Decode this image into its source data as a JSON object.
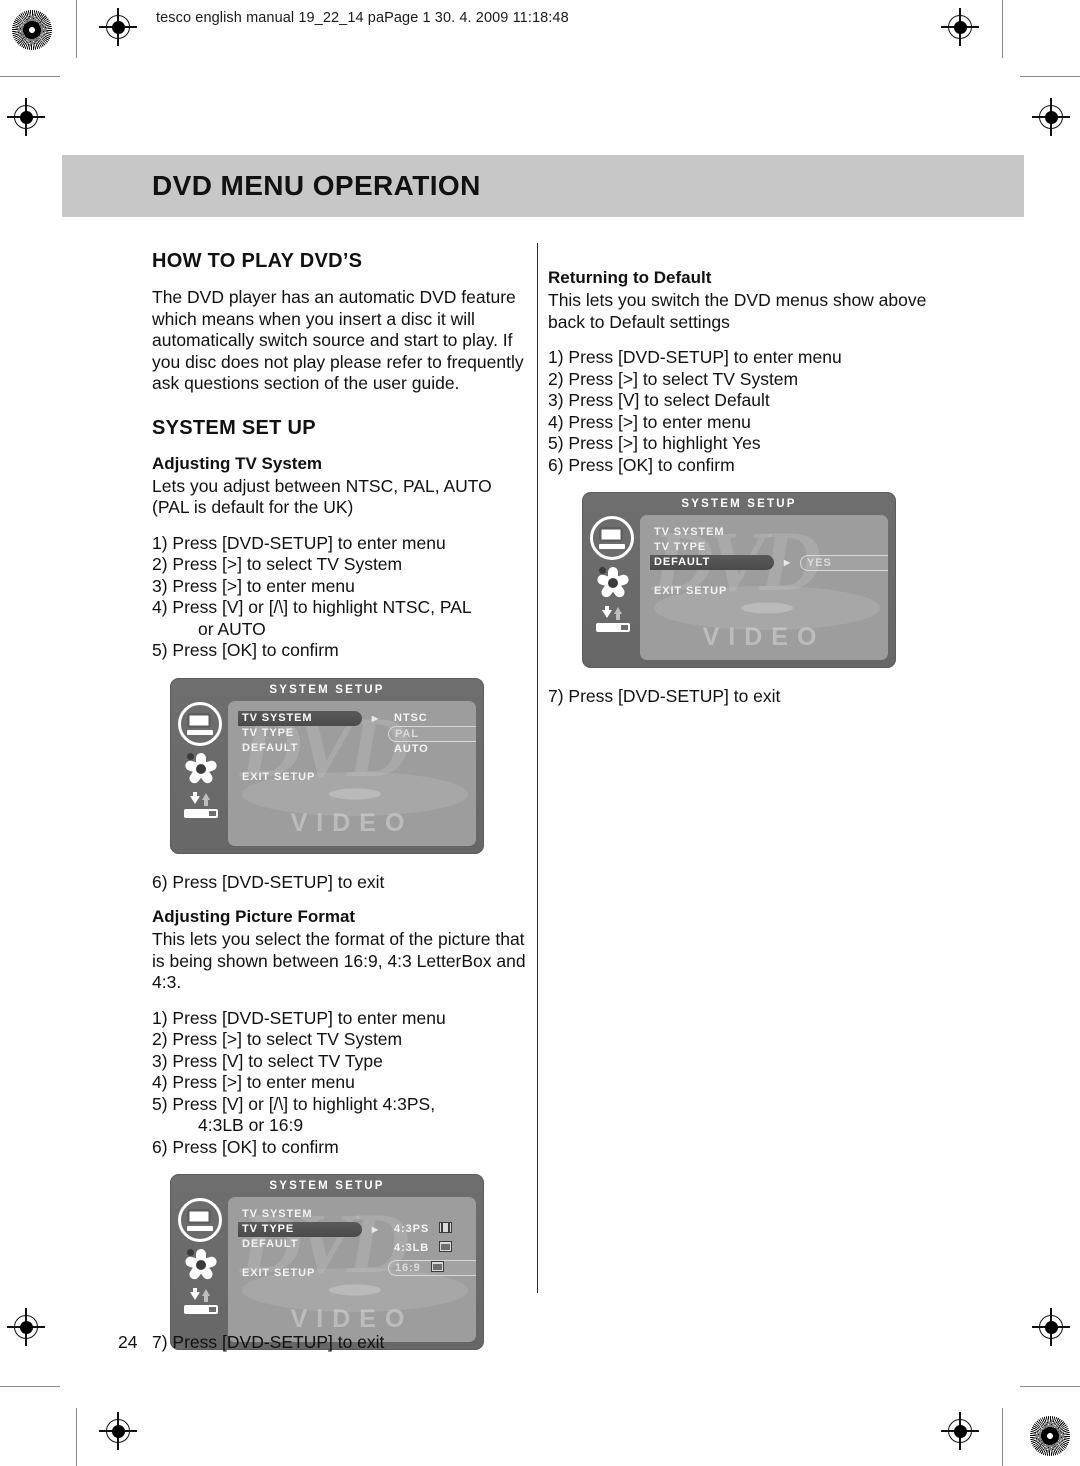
{
  "page_header": "tesco english manual 19_22_14 paPage 1   30. 4. 2009   11:18:48",
  "title": "DVD MENU OPERATION",
  "page_number": "24",
  "footer_step": "7) Press [DVD-SETUP] to exit",
  "left_column": {
    "heading": "HOW TO PLAY DVD’S",
    "intro": "The DVD player has an automatic DVD feature which means when you insert a disc it will automatically switch source and start to play. If you disc does not play please refer to frequently ask questions section of the user guide.",
    "system_heading": "SYSTEM SET UP",
    "tv_system": {
      "subheading": "Adjusting TV System",
      "body": "Lets you adjust between NTSC, PAL, AUTO (PAL is default for the UK)",
      "steps": [
        "1) Press [DVD-SETUP] to enter menu",
        "2) Press [>] to select TV System",
        "3) Press [>] to enter menu",
        "4) Press [V] or [/\\] to highlight NTSC, PAL",
        "5) Press [OK] to confirm"
      ],
      "step4_continuation": "or AUTO",
      "exit_step": "6) Press [DVD-SETUP] to exit"
    },
    "picture_format": {
      "subheading": "Adjusting Picture Format",
      "body": "This lets you select the format of the picture that is being shown between 16:9, 4:3 LetterBox and 4:3.",
      "steps": [
        "1) Press [DVD-SETUP] to enter menu",
        "2) Press [>] to select TV System",
        "3) Press [V] to select TV Type",
        "4) Press [>] to enter menu",
        "5) Press [V] or [/\\] to highlight 4:3PS,",
        "6) Press [OK] to confirm"
      ],
      "step5_continuation": "4:3LB or 16:9"
    }
  },
  "right_column": {
    "subheading": "Returning to Default",
    "body": "This lets you switch the DVD menus show above back to Default settings",
    "steps": [
      "1) Press [DVD-SETUP] to enter menu",
      "2) Press [>] to select TV System",
      "3) Press [V] to select Default",
      "4) Press [>] to enter menu",
      "5) Press [>] to highlight Yes",
      "6) Press [OK] to confirm"
    ],
    "exit_step": "7) Press [DVD-SETUP] to exit"
  },
  "osd_screens": {
    "tv_system": {
      "title": "SYSTEM SETUP",
      "menu": [
        "TV SYSTEM",
        "TV TYPE",
        "DEFAULT",
        "EXIT  SETUP"
      ],
      "selected": "TV SYSTEM",
      "values": [
        "NTSC",
        "PAL",
        "AUTO"
      ],
      "highlighted_value": "PAL",
      "watermark_dvd": "DVD",
      "watermark_video": "VIDEO"
    },
    "tv_type": {
      "title": "SYSTEM SETUP",
      "menu": [
        "TV SYSTEM",
        "TV TYPE",
        "DEFAULT",
        "EXIT  SETUP"
      ],
      "selected": "TV TYPE",
      "values": [
        "4:3PS",
        "4:3LB",
        "16:9"
      ],
      "highlighted_value": "16:9",
      "watermark_dvd": "DVD",
      "watermark_video": "VIDEO"
    },
    "default": {
      "title": "SYSTEM SETUP",
      "menu": [
        "TV SYSTEM",
        "TV TYPE",
        "DEFAULT",
        "EXIT  SETUP"
      ],
      "selected": "DEFAULT",
      "values": [
        "YES"
      ],
      "highlighted_value": "YES",
      "watermark_dvd": "DVD",
      "watermark_video": "VIDEO"
    }
  },
  "colors": {
    "title_bar": "#c7c7c7",
    "osd_frame": "#6e6e6e",
    "osd_panel": "#9d9d9d",
    "text": "#111111"
  }
}
